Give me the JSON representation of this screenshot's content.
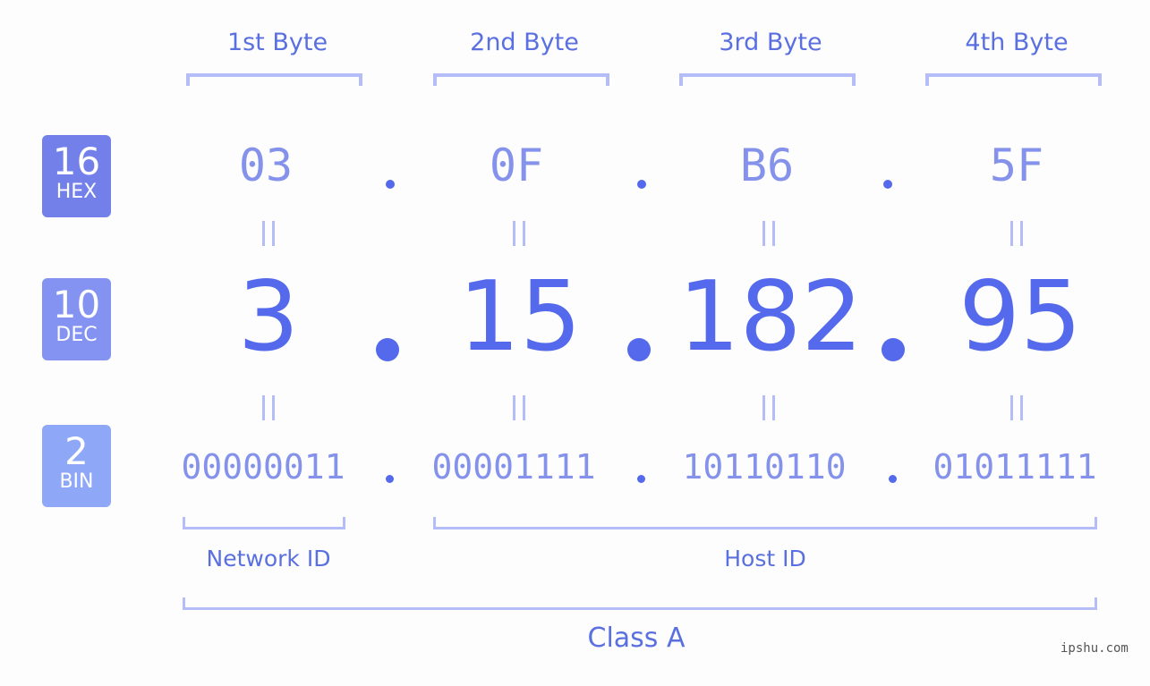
{
  "ip_address": "3.15.182.95",
  "byte_headers": [
    "1st Byte",
    "2nd Byte",
    "3rd Byte",
    "4th Byte"
  ],
  "rows": {
    "hex": {
      "base": "16",
      "label": "HEX",
      "color": "#7380ea",
      "values": [
        "03",
        "0F",
        "B6",
        "5F"
      ]
    },
    "dec": {
      "base": "10",
      "label": "DEC",
      "color": "#8493f2",
      "values": [
        "3",
        "15",
        "182",
        "95"
      ]
    },
    "bin": {
      "base": "2",
      "label": "BIN",
      "color": "#8fa7f7",
      "values": [
        "00000011",
        "00001111",
        "10110110",
        "01011111"
      ]
    }
  },
  "separator": ".",
  "segments": {
    "network_id": "Network ID",
    "host_id": "Host ID",
    "class": "Class A"
  },
  "watermark": "ipshu.com"
}
